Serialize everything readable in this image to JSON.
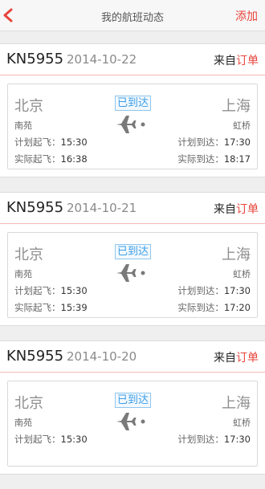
{
  "nav": {
    "title": "我的航班动态",
    "add_label": "添加"
  },
  "colors": {
    "accent": "#e8453c",
    "status": "#3a9ee8"
  },
  "icons": {
    "back": "chevron-left-icon",
    "plane": "airplane-icon"
  },
  "labels": {
    "source_prefix": "来自",
    "source_link": "订单",
    "sched_dep": "计划起飞：",
    "act_dep": "实际起飞：",
    "sched_arr": "计划到达：",
    "act_arr": "实际到达："
  },
  "flights": [
    {
      "flight_no": "KN5955",
      "date": "2014-10-22",
      "status": "已到达",
      "dep_city": "北京",
      "dep_airport": "南苑",
      "arr_city": "上海",
      "arr_airport": "虹桥",
      "sched_dep": "15:30",
      "act_dep": "16:38",
      "sched_arr": "17:30",
      "act_arr": "18:17"
    },
    {
      "flight_no": "KN5955",
      "date": "2014-10-21",
      "status": "已到达",
      "dep_city": "北京",
      "dep_airport": "南苑",
      "arr_city": "上海",
      "arr_airport": "虹桥",
      "sched_dep": "15:30",
      "act_dep": "15:39",
      "sched_arr": "17:30",
      "act_arr": "17:20"
    },
    {
      "flight_no": "KN5955",
      "date": "2014-10-20",
      "status": "已到达",
      "dep_city": "北京",
      "dep_airport": "南苑",
      "arr_city": "上海",
      "arr_airport": "虹桥",
      "sched_dep": "15:30",
      "sched_arr": "17:30"
    }
  ]
}
